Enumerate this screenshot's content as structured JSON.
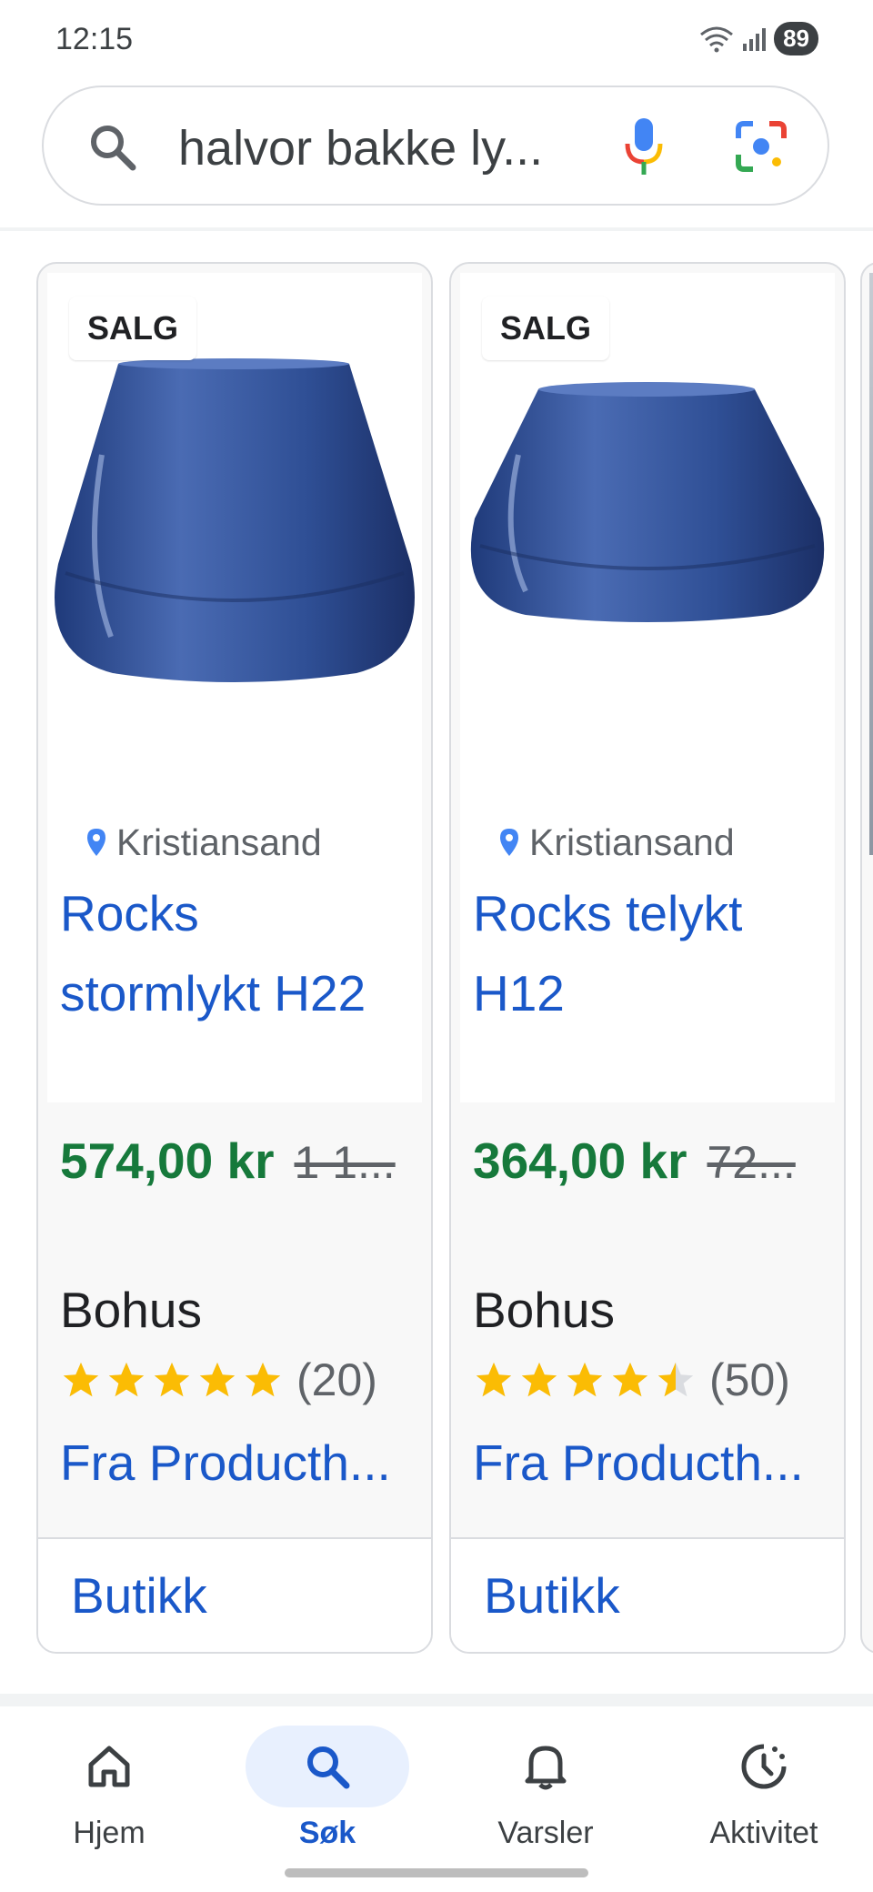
{
  "status_bar": {
    "time": "12:15",
    "battery": "89"
  },
  "search": {
    "query": "halvor bakke ly..."
  },
  "products": [
    {
      "badge": "SALG",
      "location": "Kristiansand",
      "title_line1": "Rocks",
      "title_line2": "stormlykt H22",
      "price": "574,00 kr",
      "old_price": "1 1...",
      "seller": "Bohus",
      "rating": 5,
      "review_count": "(20)",
      "source": "Fra Producth...",
      "action": "Butikk"
    },
    {
      "badge": "SALG",
      "location": "Kristiansand",
      "title_line1": "Rocks telykt",
      "title_line2": "H12",
      "price": "364,00 kr",
      "old_price": "72...",
      "seller": "Bohus",
      "rating": 4.5,
      "review_count": "(50)",
      "source": "Fra Producth...",
      "action": "Butikk"
    }
  ],
  "bottom_nav": [
    {
      "label": "Hjem",
      "icon": "home-icon"
    },
    {
      "label": "Søk",
      "icon": "search-icon",
      "active": true
    },
    {
      "label": "Varsler",
      "icon": "bell-icon"
    },
    {
      "label": "Aktivitet",
      "icon": "activity-icon"
    }
  ],
  "colors": {
    "link": "#1a58c9",
    "price": "#16793b",
    "star": "#fbbc04",
    "vase": "#2b4a8c"
  }
}
